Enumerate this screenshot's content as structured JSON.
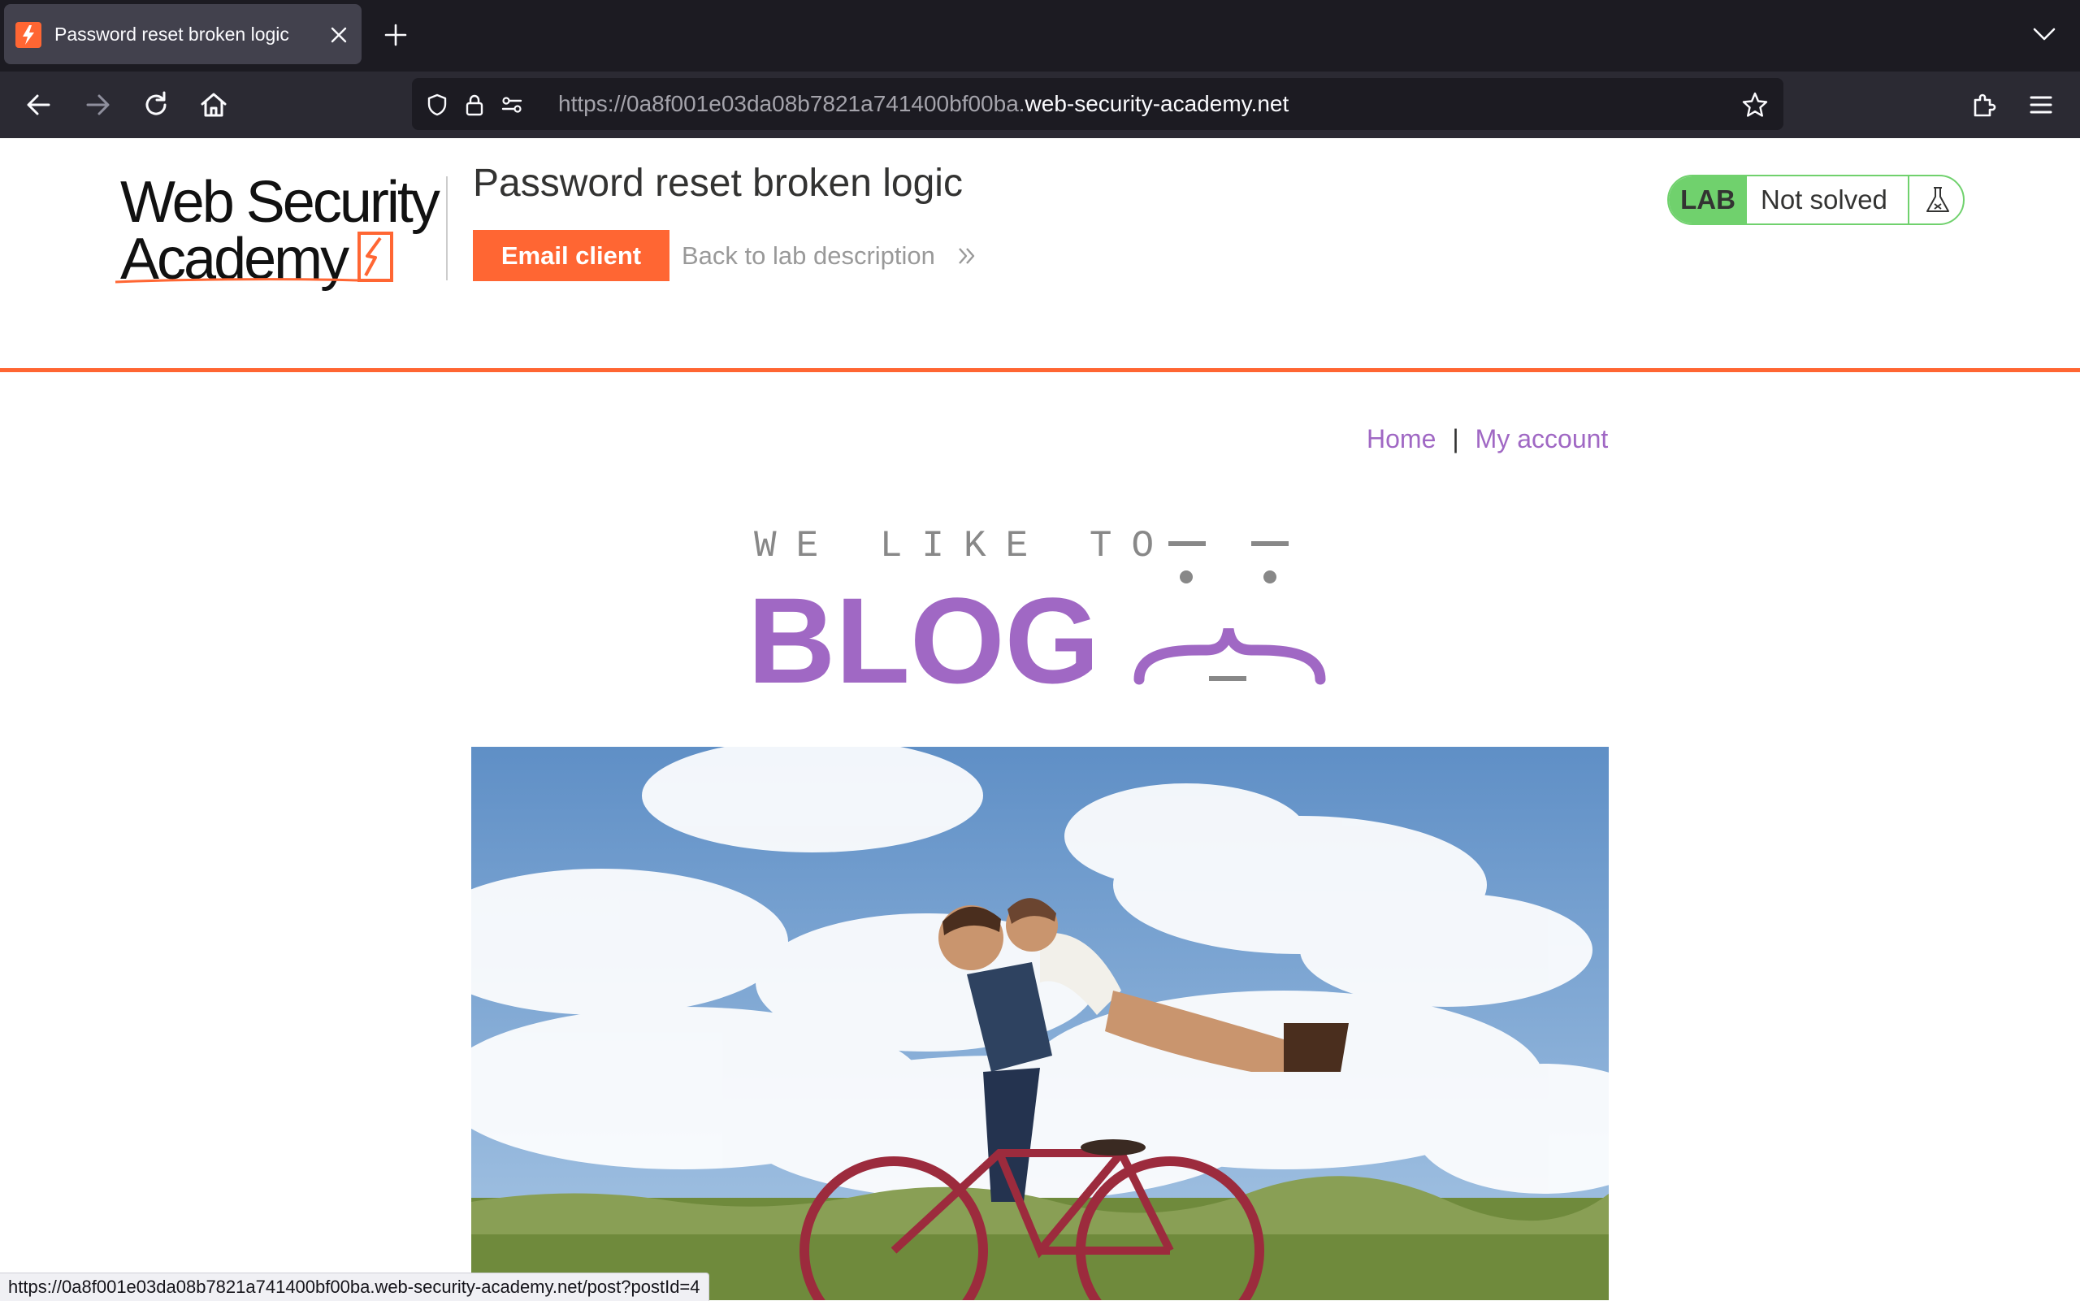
{
  "browser": {
    "tab": {
      "title": "Password reset broken logic"
    },
    "url": {
      "prefix": "https://0a8f001e03da08b7821a741400bf00ba.",
      "domain": "web-security-academy.net"
    },
    "status_bar_url": "https://0a8f001e03da08b7821a741400bf00ba.web-security-academy.net/post?postId=4"
  },
  "lab_header": {
    "logo": {
      "line1": "Web Security",
      "line2": "Academy"
    },
    "title": "Password reset broken logic",
    "email_client_label": "Email client",
    "back_link_label": "Back to lab description",
    "status": {
      "tag": "LAB",
      "text": "Not solved"
    }
  },
  "blog": {
    "nav": {
      "home": "Home",
      "separator": "|",
      "my_account": "My account"
    },
    "logo": {
      "tagline": "WE LIKE TO",
      "word": "BLOG"
    }
  },
  "colors": {
    "accent_orange": "#ff6633",
    "link_purple": "#a068c4",
    "lab_green": "#70d16d",
    "chrome_dark": "#1c1b22",
    "chrome_mid": "#2b2a33"
  },
  "icons": [
    "burp-favicon-icon",
    "close-icon",
    "plus-icon",
    "chevron-down-icon",
    "back-arrow-icon",
    "forward-arrow-icon",
    "reload-icon",
    "home-icon",
    "shield-icon",
    "lock-icon",
    "permissions-icon",
    "star-icon",
    "extensions-icon",
    "menu-icon",
    "double-chevron-right-icon",
    "flask-icon"
  ]
}
